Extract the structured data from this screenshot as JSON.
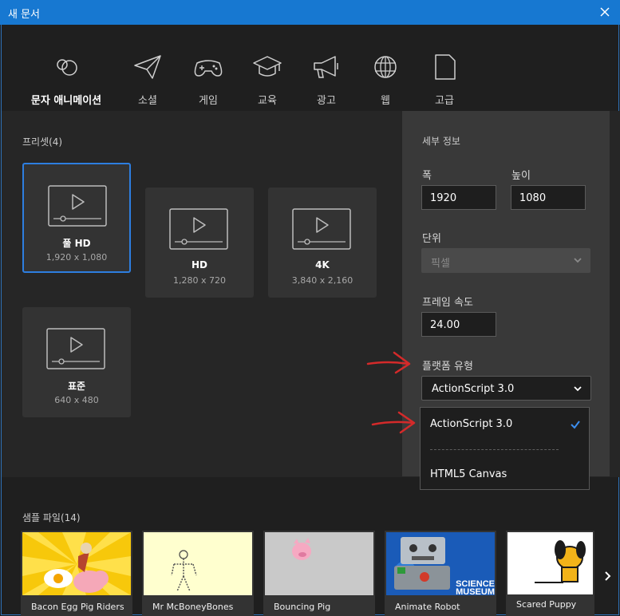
{
  "window": {
    "title": "새 문서"
  },
  "categories": [
    {
      "label": "문자 애니메이션",
      "icon": "character-animation-icon",
      "active": true
    },
    {
      "label": "소셜",
      "icon": "paper-plane-icon"
    },
    {
      "label": "게임",
      "icon": "gamepad-icon"
    },
    {
      "label": "교육",
      "icon": "graduation-cap-icon"
    },
    {
      "label": "광고",
      "icon": "megaphone-icon"
    },
    {
      "label": "웹",
      "icon": "globe-icon"
    },
    {
      "label": "고급",
      "icon": "document-icon"
    }
  ],
  "presets": {
    "title": "프리셋(4)",
    "items": [
      {
        "name": "풀 HD",
        "size": "1,920 x 1,080",
        "selected": true
      },
      {
        "name": "HD",
        "size": "1,280 x 720"
      },
      {
        "name": "4K",
        "size": "3,840 x 2,160"
      },
      {
        "name": "표준",
        "size": "640 x 480"
      }
    ]
  },
  "details": {
    "title": "세부 정보",
    "width_label": "폭",
    "width_value": "1920",
    "height_label": "높이",
    "height_value": "1080",
    "units_label": "단위",
    "units_value": "픽셀",
    "frame_rate_label": "프레임 속도",
    "frame_rate_value": "24.00",
    "platform_label": "플랫폼 유형",
    "platform_value": "ActionScript 3.0",
    "platform_options": [
      "ActionScript 3.0",
      "HTML5 Canvas"
    ]
  },
  "samples": {
    "title": "샘플 파일(14)",
    "items": [
      {
        "name": "Bacon Egg Pig Riders"
      },
      {
        "name": "Mr McBoneyBones"
      },
      {
        "name": "Bouncing Pig"
      },
      {
        "name": "Animate Robot",
        "badge_lines": [
          "SCIENCE",
          "MUSEUM"
        ]
      },
      {
        "name": "Scared Puppy"
      }
    ]
  },
  "colors": {
    "accent": "#2d7ee0",
    "titlebar": "#1778d1",
    "annotation": "#d42a2a"
  }
}
